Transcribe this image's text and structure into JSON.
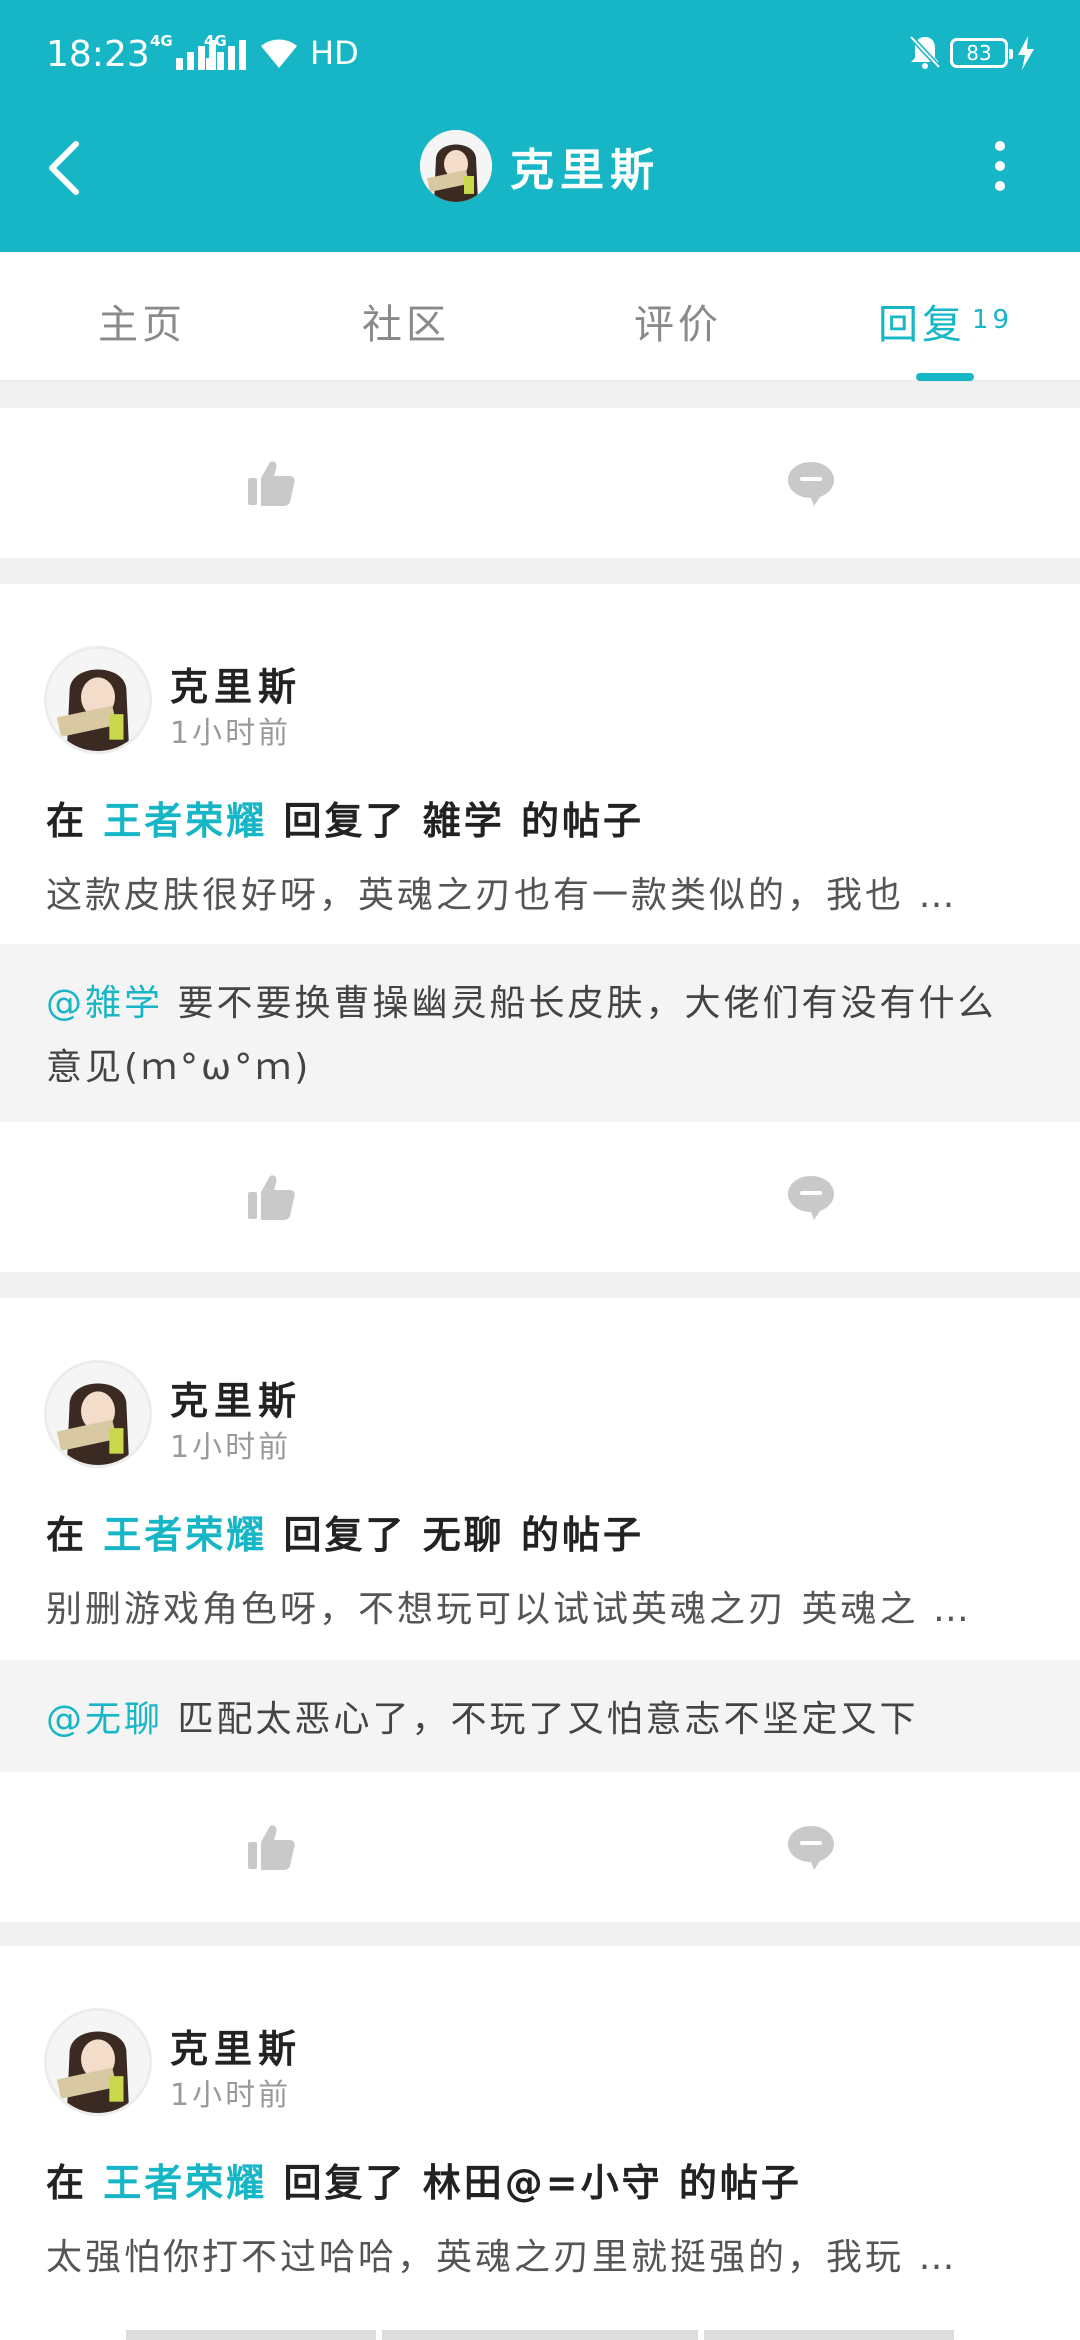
{
  "status_bar": {
    "time": "18:23",
    "net1": "4G",
    "net2": "4G",
    "hd": "HD",
    "battery": "83"
  },
  "nav": {
    "title": "克里斯"
  },
  "tabs": [
    {
      "label": "主页"
    },
    {
      "label": "社区"
    },
    {
      "label": "评价"
    },
    {
      "label": "回复",
      "count": "19"
    }
  ],
  "posts": [
    {
      "user": "克里斯",
      "time": "1小时前",
      "prefix": "在",
      "game": "王者荣耀",
      "middle": "回复了",
      "target": "雑学",
      "suffix": "的帖子",
      "excerpt": "这款皮肤很好呀，英魂之刃也有一款类似的，我也 …",
      "quote_at": "@雑学",
      "quote_text": "要不要换曹操幽灵船长皮肤，大佬们有没有什么意见(ｍ°ω°ｍ)"
    },
    {
      "user": "克里斯",
      "time": "1小时前",
      "prefix": "在",
      "game": "王者荣耀",
      "middle": "回复了",
      "target": "无聊",
      "suffix": "的帖子",
      "excerpt": "别删游戏角色呀，不想玩可以试试英魂之刃 英魂之 …",
      "quote_at": "@无聊",
      "quote_text": "匹配太恶心了，不玩了又怕意志不坚定又下"
    },
    {
      "user": "克里斯",
      "time": "1小时前",
      "prefix": "在",
      "game": "王者荣耀",
      "middle": "回复了",
      "target": "林田@=小守",
      "suffix": "的帖子",
      "excerpt": "太强怕你打不过哈哈，英魂之刃里就挺强的，我玩 …"
    }
  ],
  "colors": {
    "accent": "#17b6c6",
    "icon_gray": "#c9c9c9"
  }
}
